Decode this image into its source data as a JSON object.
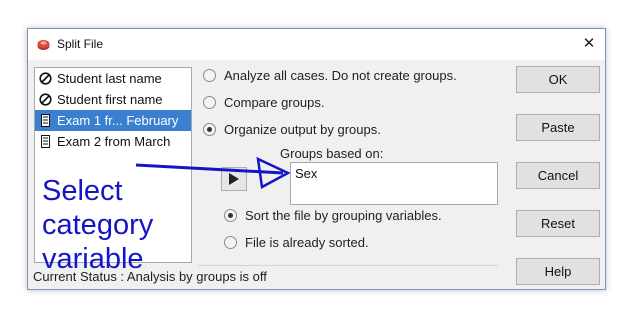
{
  "window": {
    "title": "Split File",
    "close_glyph": "✕"
  },
  "variables": [
    {
      "label": "Student last name",
      "icon": "nominal-variable-icon",
      "selected": false
    },
    {
      "label": "Student first name",
      "icon": "nominal-variable-icon",
      "selected": false
    },
    {
      "label": "Exam 1 fr... February",
      "icon": "scale-variable-icon",
      "selected": true
    },
    {
      "label": "Exam 2 from March",
      "icon": "scale-variable-icon",
      "selected": false
    }
  ],
  "options": {
    "analyze_all": "Analyze all cases.  Do not create groups.",
    "compare": "Compare groups.",
    "organize": "Organize output by groups.",
    "selected": "organize"
  },
  "groups": {
    "label": "Groups based on:",
    "entries": [
      "Sex"
    ]
  },
  "sort": {
    "sort_label": "Sort the file by grouping variables.",
    "sorted_label": "File is already sorted.",
    "selected": "sort"
  },
  "status": "Current Status : Analysis by groups is off",
  "buttons": {
    "ok": "OK",
    "paste": "Paste",
    "cancel": "Cancel",
    "reset": "Reset",
    "help": "Help"
  },
  "annotation": {
    "text": "Select category variable",
    "color": "#1414c8"
  },
  "colors": {
    "selection": "#3b7fd0"
  }
}
